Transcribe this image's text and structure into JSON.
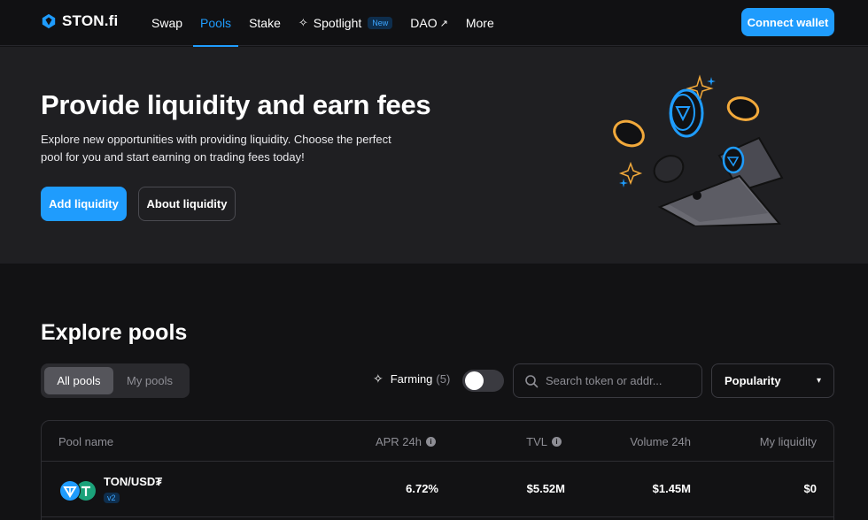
{
  "header": {
    "logo_text": "STON.fi",
    "nav": [
      {
        "label": "Swap"
      },
      {
        "label": "Pools",
        "active": true
      },
      {
        "label": "Stake"
      },
      {
        "label": "Spotlight",
        "badge": "New"
      },
      {
        "label": "DAO",
        "external": true
      },
      {
        "label": "More"
      }
    ],
    "connect_label": "Connect wallet"
  },
  "hero": {
    "title": "Provide liquidity and earn fees",
    "description": "Explore new opportunities with providing liquidity. Choose the perfect pool for you and start earning on trading fees today!",
    "primary_label": "Add liquidity",
    "secondary_label": "About liquidity"
  },
  "explore": {
    "title": "Explore pools",
    "tabs": [
      {
        "label": "All pools",
        "active": true
      },
      {
        "label": "My pools"
      }
    ],
    "farming_label": "Farming",
    "farming_count": "(5)",
    "search_placeholder": "Search token or addr...",
    "sort_label": "Popularity"
  },
  "table": {
    "columns": [
      "Pool name",
      "APR 24h",
      "TVL",
      "Volume 24h",
      "My liquidity"
    ],
    "rows": [
      {
        "pair": "TON/USD₮",
        "version": "v2",
        "apr": "6.72%",
        "tvl": "$5.52M",
        "volume": "$1.45M",
        "my_liquidity": "$0"
      }
    ]
  },
  "colors": {
    "accent": "#1f9cfd",
    "background": "#121214",
    "hero_bg": "#1f1f22"
  }
}
